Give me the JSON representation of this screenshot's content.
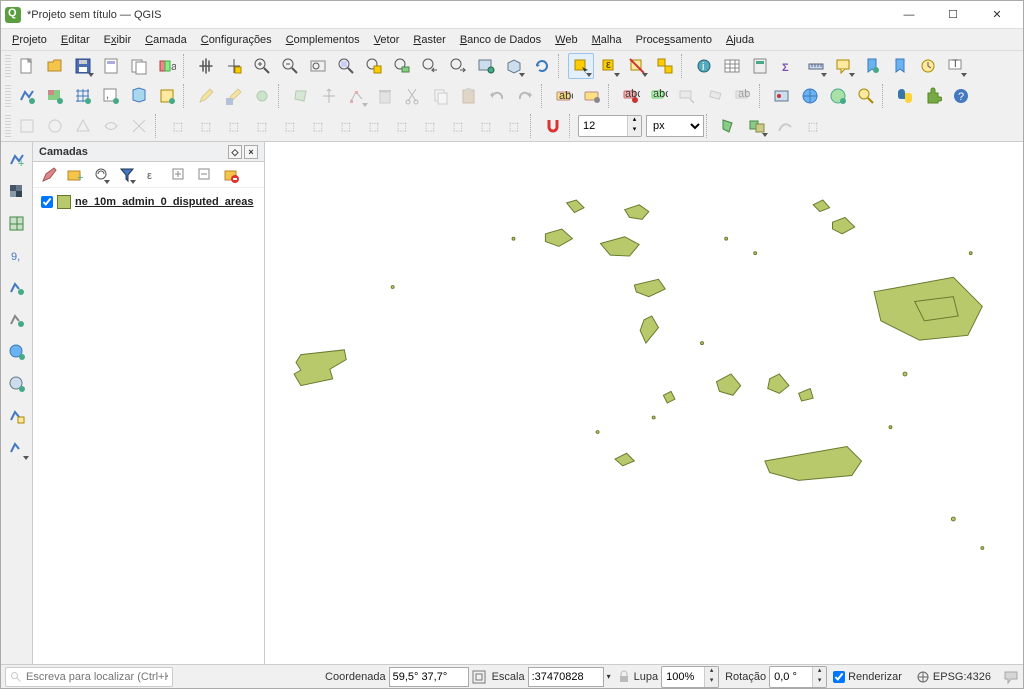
{
  "window": {
    "title": "*Projeto sem título — QGIS"
  },
  "menu": [
    "Projeto",
    "Editar",
    "Exibir",
    "Camada",
    "Configurações",
    "Complementos",
    "Vetor",
    "Raster",
    "Banco de Dados",
    "Web",
    "Malha",
    "Processamento",
    "Ajuda"
  ],
  "snap": {
    "value": "12",
    "unit": "px"
  },
  "layers_panel": {
    "title": "Camadas",
    "layer": {
      "name": "ne_10m_admin_0_disputed_areas",
      "checked": true,
      "swatch": "#b7c96b"
    }
  },
  "statusbar": {
    "locator_placeholder": "Escreva para localizar (Ctrl+K)",
    "coord_label": "Coordenada",
    "coord_value": "59,5° 37,7°",
    "scale_label": "Escala",
    "scale_value": ":37470828",
    "lupa_label": "Lupa",
    "lupa_value": "100%",
    "rot_label": "Rotação",
    "rot_value": "0,0 °",
    "render_label": "Renderizar",
    "crs": "EPSG:4326"
  },
  "icons": {
    "new": "new-file",
    "open": "open-folder",
    "save": "save",
    "save_as": "save-as",
    "print": "print-layout",
    "style": "style-manager",
    "pan": "pan",
    "pan_sel": "pan-to-selection",
    "zoom_in": "zoom-in",
    "zoom_out": "zoom-out",
    "zoom_full": "zoom-full",
    "zoom_sel": "zoom-to-selection",
    "zoom_layer": "zoom-to-layer",
    "zoom_native": "zoom-native",
    "zoom_last": "zoom-last",
    "zoom_next": "zoom-next",
    "new_map": "new-map-view",
    "refresh": "refresh",
    "select": "select-features",
    "select_value": "select-by-value",
    "deselect": "deselect",
    "select_all": "select-all",
    "identify": "identify",
    "attr_table": "attribute-table",
    "field_calc": "field-calculator",
    "toolbox": "processing-toolbox",
    "stats": "statistics",
    "measure": "measure",
    "map_tips": "map-tips",
    "text_ann": "text-annotation",
    "bookmark": "new-bookmark",
    "bookmarks": "bookmarks",
    "temporal": "temporal",
    "edit": "toggle-editing",
    "save_edits": "save-edits",
    "add_feat": "add-feature",
    "move_feat": "move-feature",
    "node": "node-tool",
    "delete": "delete-selected",
    "cut": "cut-features",
    "copy": "copy-features",
    "paste": "paste-features",
    "undo": "undo",
    "redo": "redo",
    "label": "label",
    "label_cfg": "label-config",
    "label_pin": "label-pin",
    "label_show": "label-show",
    "label_move": "label-move",
    "label_rot": "label-rotate",
    "label_prop": "label-properties",
    "snap": "snapping",
    "vertex": "vertex-tool",
    "topo": "topological-editing",
    "trace": "trace",
    "db": "db-manager",
    "globe": "globe",
    "fusion": "fusion",
    "python": "python-console",
    "plugins": "plugins",
    "help": "help",
    "add_grp": "add-group",
    "mng_themes": "manage-themes",
    "filter": "filter-legend",
    "expr": "filter-expression",
    "expand": "expand-all",
    "collapse": "collapse-all",
    "remove": "remove-layer"
  }
}
